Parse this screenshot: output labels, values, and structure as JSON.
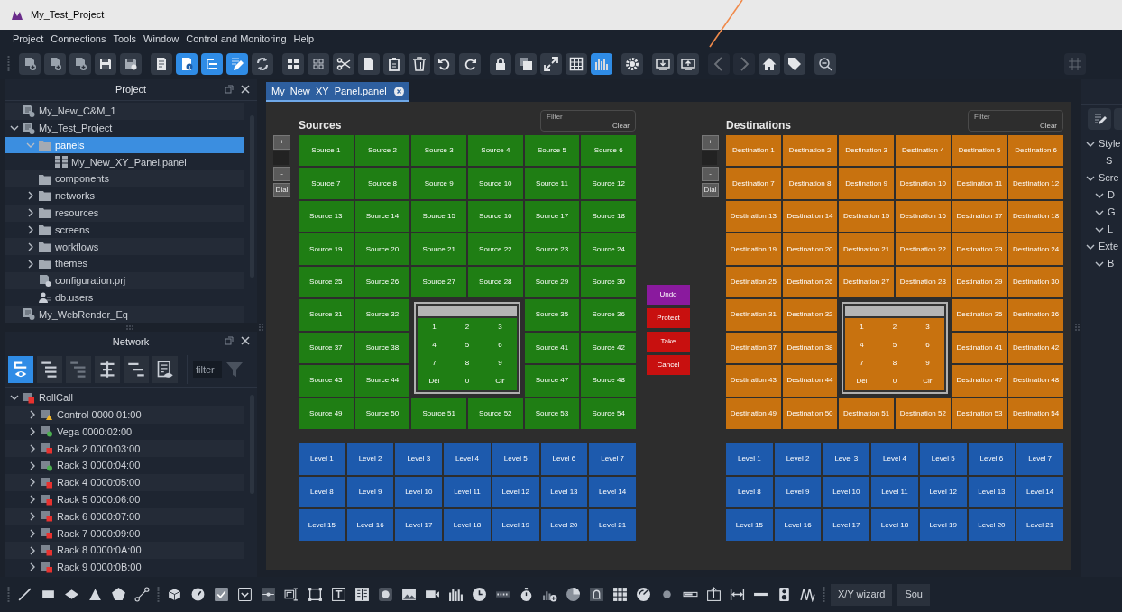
{
  "window": {
    "title": "My_Test_Project"
  },
  "menu": [
    "Project",
    "Connections",
    "Tools",
    "Window",
    "Control and Monitoring",
    "Help"
  ],
  "toolbar": [
    [
      {
        "kind": "new-project",
        "selected": false,
        "disabled": false
      },
      {
        "kind": "new-project",
        "selected": false,
        "disabled": false
      },
      {
        "kind": "new-project",
        "selected": false,
        "disabled": false
      },
      {
        "kind": "save",
        "selected": false,
        "disabled": false
      },
      {
        "kind": "save-as",
        "selected": false,
        "disabled": false
      }
    ],
    [
      {
        "kind": "report",
        "selected": false,
        "disabled": false
      },
      {
        "kind": "info-doc",
        "selected": true,
        "disabled": false
      },
      {
        "kind": "tree",
        "selected": true,
        "disabled": false
      },
      {
        "kind": "edit",
        "selected": true,
        "disabled": false
      },
      {
        "kind": "sync",
        "selected": false,
        "disabled": false
      }
    ],
    [
      {
        "kind": "grid",
        "selected": false,
        "disabled": false
      },
      {
        "kind": "grid-small",
        "selected": false,
        "disabled": false
      },
      {
        "kind": "cut",
        "selected": false,
        "disabled": false
      },
      {
        "kind": "page",
        "selected": false,
        "disabled": false
      },
      {
        "kind": "clipboard",
        "selected": false,
        "disabled": false
      },
      {
        "kind": "trash",
        "selected": false,
        "disabled": false
      },
      {
        "kind": "undo",
        "selected": false,
        "disabled": false
      },
      {
        "kind": "redo",
        "selected": false,
        "disabled": false
      }
    ],
    [
      {
        "kind": "lock",
        "selected": false,
        "disabled": false
      },
      {
        "kind": "layers",
        "selected": false,
        "disabled": false
      },
      {
        "kind": "expand",
        "selected": false,
        "disabled": false
      },
      {
        "kind": "table",
        "selected": false,
        "disabled": false
      },
      {
        "kind": "bars",
        "selected": true,
        "disabled": false
      }
    ],
    [
      {
        "kind": "gear",
        "selected": false,
        "disabled": false
      }
    ],
    [
      {
        "kind": "monitor-down",
        "selected": false,
        "disabled": false
      },
      {
        "kind": "monitor-up",
        "selected": false,
        "disabled": false
      }
    ],
    [
      {
        "kind": "back",
        "selected": false,
        "disabled": true
      },
      {
        "kind": "forward",
        "selected": false,
        "disabled": true
      },
      {
        "kind": "home",
        "selected": false,
        "disabled": false
      },
      {
        "kind": "tag",
        "selected": false,
        "disabled": false
      }
    ],
    [
      {
        "kind": "zoom-out",
        "selected": false,
        "disabled": false
      }
    ],
    [
      {
        "kind": "grid-lines",
        "selected": false,
        "disabled": true
      }
    ]
  ],
  "project_panel": {
    "title": "Project",
    "tree": [
      {
        "label": "My_New_C&M_1",
        "kind": "project",
        "selected": false
      },
      {
        "label": "My_Test_Project",
        "kind": "project",
        "selected": false,
        "expanded": true,
        "children": [
          {
            "label": "panels",
            "kind": "folder",
            "selected": true,
            "expanded": true,
            "children": [
              {
                "label": "My_New_XY_Panel.panel",
                "kind": "panel",
                "selected": false
              }
            ]
          },
          {
            "label": "components",
            "kind": "folder",
            "selected": false
          },
          {
            "label": "networks",
            "kind": "folder",
            "selected": false,
            "expanded": false
          },
          {
            "label": "resources",
            "kind": "folder",
            "selected": false,
            "expanded": false
          },
          {
            "label": "screens",
            "kind": "folder",
            "selected": false,
            "expanded": false
          },
          {
            "label": "workflows",
            "kind": "folder",
            "selected": false,
            "expanded": false
          },
          {
            "label": "themes",
            "kind": "folder",
            "selected": false,
            "expanded": false
          },
          {
            "label": "configuration.prj",
            "kind": "config",
            "selected": false
          },
          {
            "label": "db.users",
            "kind": "users",
            "selected": false
          }
        ]
      },
      {
        "label": "My_WebRender_Eq",
        "kind": "project",
        "selected": false
      }
    ]
  },
  "network_panel": {
    "title": "Network",
    "tools": [
      {
        "kind": "network-view",
        "selected": true
      },
      {
        "kind": "tree-expand",
        "selected": false
      },
      {
        "kind": "tree-collapse",
        "selected": false
      },
      {
        "kind": "align",
        "selected": false
      },
      {
        "kind": "tree-levels",
        "selected": false
      },
      {
        "kind": "list-view",
        "selected": false
      }
    ],
    "filter": {
      "placeholder": "filter"
    },
    "tree": [
      {
        "label": "RollCall",
        "kind": "square",
        "color": "#e8322f",
        "expanded": true,
        "children": [
          {
            "label": "Control 0000:01:00",
            "kind": "triangle",
            "color": "#f0b429",
            "expanded": false
          },
          {
            "label": "Vega 0000:02:00",
            "kind": "dot",
            "color": "#4caf50",
            "expanded": false
          },
          {
            "label": "Rack 2 0000:03:00",
            "kind": "square",
            "color": "#e8322f",
            "expanded": false
          },
          {
            "label": "Rack 3 0000:04:00",
            "kind": "dot",
            "color": "#4caf50",
            "expanded": false
          },
          {
            "label": "Rack 4 0000:05:00",
            "kind": "square",
            "color": "#e8322f",
            "expanded": false
          },
          {
            "label": "Rack 5 0000:06:00",
            "kind": "square",
            "color": "#e8322f",
            "expanded": false
          },
          {
            "label": "Rack 6 0000:07:00",
            "kind": "square",
            "color": "#e8322f",
            "expanded": false
          },
          {
            "label": "Rack 7 0000:09:00",
            "kind": "square",
            "color": "#e8322f",
            "expanded": false
          },
          {
            "label": "Rack 8 0000:0A:00",
            "kind": "square",
            "color": "#e8322f",
            "expanded": false
          },
          {
            "label": "Rack 9 0000:0B:00",
            "kind": "square",
            "color": "#e8322f",
            "expanded": false
          }
        ]
      }
    ]
  },
  "editor": {
    "tabs": [
      {
        "label": "My_New_XY_Panel.panel",
        "selected": true
      }
    ],
    "panels": [
      {
        "kind": "source",
        "title": "Sources",
        "filter": {
          "label": "Filter",
          "button": "Clear"
        },
        "side_controls": [
          {
            "kind": "button",
            "label": "+"
          },
          {
            "kind": "field"
          },
          {
            "kind": "button",
            "label": "-"
          },
          {
            "kind": "button",
            "label": "Dial"
          }
        ],
        "cells": [
          "Source 1",
          "Source 2",
          "Source 3",
          "Source 4",
          "Source 5",
          "Source 6",
          "Source 7",
          "Source 8",
          "Source 9",
          "Source 10",
          "Source 11",
          "Source 12",
          "Source 13",
          "Source 14",
          "Source 15",
          "Source 16",
          "Source 17",
          "Source 18",
          "Source 19",
          "Source 20",
          "Source 21",
          "Source 22",
          "Source 23",
          "Source 24",
          "Source 25",
          "Source 26",
          "Source 27",
          "Source 28",
          "Source 29",
          "Source 30",
          "Source 31",
          "Source 32",
          null,
          null,
          "Source 35",
          "Source 36",
          "Source 37",
          "Source 38",
          null,
          null,
          "Source 41",
          "Source 42",
          "Source 43",
          "Source 44",
          null,
          null,
          "Source 47",
          "Source 48",
          "Source 49",
          "Source 50",
          "Source 51",
          "Source 52",
          "Source 53",
          "Source 54"
        ],
        "keypad": [
          "1",
          "2",
          "3",
          "4",
          "5",
          "6",
          "7",
          "8",
          "9",
          "Del",
          "0",
          "Clr"
        ],
        "levels": [
          "Level 1",
          "Level 2",
          "Level 3",
          "Level 4",
          "Level 5",
          "Level 6",
          "Level 7",
          "Level 8",
          "Level 9",
          "Level 10",
          "Level 11",
          "Level 12",
          "Level 13",
          "Level 14",
          "Level 15",
          "Level 16",
          "Level 17",
          "Level 18",
          "Level 19",
          "Level 20",
          "Level 21"
        ]
      },
      {
        "kind": "destination",
        "title": "Destinations",
        "filter": {
          "label": "Filter",
          "button": "Clear"
        },
        "side_controls": [
          {
            "kind": "button",
            "label": "+"
          },
          {
            "kind": "field"
          },
          {
            "kind": "button",
            "label": "-"
          },
          {
            "kind": "button",
            "label": "Dial"
          }
        ],
        "cells": [
          "Destination 1",
          "Destination 2",
          "Destination 3",
          "Destination 4",
          "Destination 5",
          "Destination 6",
          "Destination 7",
          "Destination 8",
          "Destination 9",
          "Destination 10",
          "Destination 11",
          "Destination 12",
          "Destination 13",
          "Destination 14",
          "Destination 15",
          "Destination 16",
          "Destination 17",
          "Destination 18",
          "Destination 19",
          "Destination 20",
          "Destination 21",
          "Destination 22",
          "Destination 23",
          "Destination 24",
          "Destination 25",
          "Destination 26",
          "Destination 27",
          "Destination 28",
          "Destination 29",
          "Destination 30",
          "Destination 31",
          "Destination 32",
          null,
          null,
          "Destination 35",
          "Destination 36",
          "Destination 37",
          "Destination 38",
          null,
          null,
          "Destination 41",
          "Destination 42",
          "Destination 43",
          "Destination 44",
          null,
          null,
          "Destination 47",
          "Destination 48",
          "Destination 49",
          "Destination 50",
          "Destination 51",
          "Destination 52",
          "Destination 53",
          "Destination 54"
        ],
        "keypad": [
          "1",
          "2",
          "3",
          "4",
          "5",
          "6",
          "7",
          "8",
          "9",
          "Del",
          "0",
          "Clr"
        ],
        "levels": [
          "Level 1",
          "Level 2",
          "Level 3",
          "Level 4",
          "Level 5",
          "Level 6",
          "Level 7",
          "Level 8",
          "Level 9",
          "Level 10",
          "Level 11",
          "Level 12",
          "Level 13",
          "Level 14",
          "Level 15",
          "Level 16",
          "Level 17",
          "Level 18",
          "Level 19",
          "Level 20",
          "Level 21"
        ]
      }
    ],
    "actions": [
      {
        "label": "Undo",
        "kind": "undo"
      },
      {
        "label": "Protect",
        "kind": "danger"
      },
      {
        "label": "Take",
        "kind": "danger"
      },
      {
        "label": "Cancel",
        "kind": "danger"
      }
    ]
  },
  "properties_panel": {
    "tree": [
      {
        "label": "Style",
        "expanded": true,
        "children": [
          {
            "label": "S"
          }
        ]
      },
      {
        "label": "Scre",
        "expanded": true,
        "children": [
          {
            "label": "D",
            "expanded": true
          },
          {
            "label": "G",
            "expanded": true
          },
          {
            "label": "L",
            "expanded": true
          }
        ]
      },
      {
        "label": "Exte",
        "expanded": true,
        "children": [
          {
            "label": "B",
            "expanded": true
          }
        ]
      }
    ]
  },
  "bottom_toolbar": {
    "tools": [
      [
        {
          "kind": "line"
        },
        {
          "kind": "rect"
        },
        {
          "kind": "ellipse"
        },
        {
          "kind": "triangle"
        },
        {
          "kind": "star"
        },
        {
          "kind": "nodes"
        }
      ],
      [
        {
          "kind": "box3d"
        },
        {
          "kind": "gauge"
        },
        {
          "kind": "check"
        },
        {
          "kind": "checkbox"
        },
        {
          "kind": "slider"
        },
        {
          "kind": "label"
        },
        {
          "kind": "frame"
        },
        {
          "kind": "text"
        },
        {
          "kind": "book"
        },
        {
          "kind": "round-button"
        },
        {
          "kind": "image"
        },
        {
          "kind": "video"
        },
        {
          "kind": "bars"
        },
        {
          "kind": "clock"
        },
        {
          "kind": "counter"
        },
        {
          "kind": "timer"
        },
        {
          "kind": "chart-add"
        },
        {
          "kind": "pie"
        },
        {
          "kind": "alarm"
        },
        {
          "kind": "dots"
        },
        {
          "kind": "radar"
        },
        {
          "kind": "dot"
        },
        {
          "kind": "progress"
        },
        {
          "kind": "picture-frame"
        },
        {
          "kind": "range"
        },
        {
          "kind": "dash"
        },
        {
          "kind": "speaker"
        },
        {
          "kind": "wave"
        }
      ]
    ],
    "buttons": [
      "X/Y wizard",
      "Sou"
    ]
  }
}
